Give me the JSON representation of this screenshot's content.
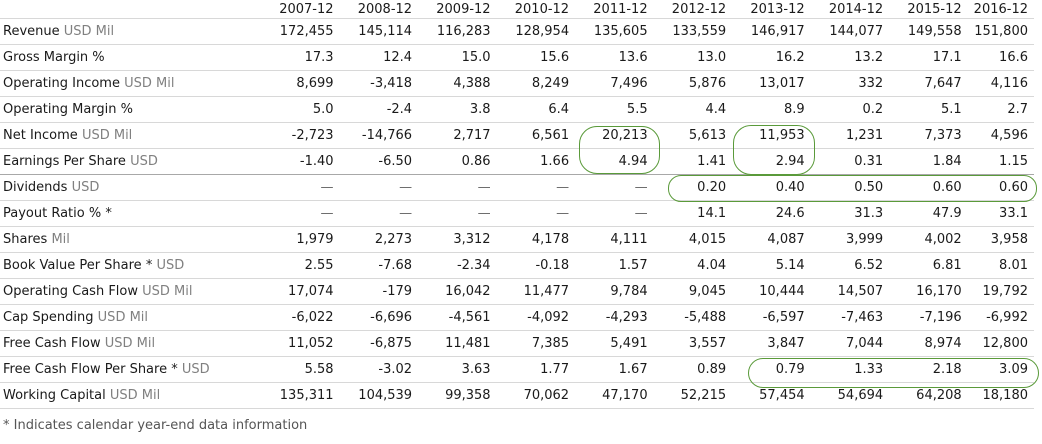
{
  "years": [
    "2007-12",
    "2008-12",
    "2009-12",
    "2010-12",
    "2011-12",
    "2012-12",
    "2013-12",
    "2014-12",
    "2015-12",
    "2016-12"
  ],
  "rows": [
    {
      "metric": "Revenue",
      "unit": "USD Mil",
      "values": [
        "172,455",
        "145,114",
        "116,283",
        "128,954",
        "135,605",
        "133,559",
        "146,917",
        "144,077",
        "149,558",
        "151,800"
      ]
    },
    {
      "metric": "Gross Margin %",
      "unit": "",
      "values": [
        "17.3",
        "12.4",
        "15.0",
        "15.6",
        "13.6",
        "13.0",
        "16.2",
        "13.2",
        "17.1",
        "16.6"
      ]
    },
    {
      "metric": "Operating Income",
      "unit": "USD Mil",
      "values": [
        "8,699",
        "-3,418",
        "4,388",
        "8,249",
        "7,496",
        "5,876",
        "13,017",
        "332",
        "7,647",
        "4,116"
      ]
    },
    {
      "metric": "Operating Margin %",
      "unit": "",
      "values": [
        "5.0",
        "-2.4",
        "3.8",
        "6.4",
        "5.5",
        "4.4",
        "8.9",
        "0.2",
        "5.1",
        "2.7"
      ]
    },
    {
      "metric": "Net Income",
      "unit": "USD Mil",
      "values": [
        "-2,723",
        "-14,766",
        "2,717",
        "6,561",
        "20,213",
        "5,613",
        "11,953",
        "1,231",
        "7,373",
        "4,596"
      ]
    },
    {
      "metric": "Earnings Per Share",
      "unit": "USD",
      "values": [
        "-1.40",
        "-6.50",
        "0.86",
        "1.66",
        "4.94",
        "1.41",
        "2.94",
        "0.31",
        "1.84",
        "1.15"
      ]
    },
    {
      "metric": "Dividends",
      "unit": "USD",
      "values": [
        "—",
        "—",
        "—",
        "—",
        "—",
        "0.20",
        "0.40",
        "0.50",
        "0.60",
        "0.60"
      ]
    },
    {
      "metric": "Payout Ratio % *",
      "unit": "",
      "values": [
        "—",
        "—",
        "—",
        "—",
        "—",
        "14.1",
        "24.6",
        "31.3",
        "47.9",
        "33.1"
      ]
    },
    {
      "metric": "Shares",
      "unit": "Mil",
      "values": [
        "1,979",
        "2,273",
        "3,312",
        "4,178",
        "4,111",
        "4,015",
        "4,087",
        "3,999",
        "4,002",
        "3,958"
      ]
    },
    {
      "metric": "Book Value Per Share *",
      "unit": "USD",
      "values": [
        "2.55",
        "-7.68",
        "-2.34",
        "-0.18",
        "1.57",
        "4.04",
        "5.14",
        "6.52",
        "6.81",
        "8.01"
      ]
    },
    {
      "metric": "Operating Cash Flow",
      "unit": "USD Mil",
      "values": [
        "17,074",
        "-179",
        "16,042",
        "11,477",
        "9,784",
        "9,045",
        "10,444",
        "14,507",
        "16,170",
        "19,792"
      ]
    },
    {
      "metric": "Cap Spending",
      "unit": "USD Mil",
      "values": [
        "-6,022",
        "-6,696",
        "-4,561",
        "-4,092",
        "-4,293",
        "-5,488",
        "-6,597",
        "-7,463",
        "-7,196",
        "-6,992"
      ]
    },
    {
      "metric": "Free Cash Flow",
      "unit": "USD Mil",
      "values": [
        "11,052",
        "-6,875",
        "11,481",
        "7,385",
        "5,491",
        "3,557",
        "3,847",
        "7,044",
        "8,974",
        "12,800"
      ]
    },
    {
      "metric": "Free Cash Flow Per Share *",
      "unit": "USD",
      "values": [
        "5.58",
        "-3.02",
        "3.63",
        "1.77",
        "1.67",
        "0.89",
        "0.79",
        "1.33",
        "2.18",
        "3.09"
      ]
    },
    {
      "metric": "Working Capital",
      "unit": "USD Mil",
      "values": [
        "135,311",
        "104,539",
        "99,358",
        "70,062",
        "47,170",
        "52,215",
        "57,454",
        "54,694",
        "64,208",
        "18,180"
      ]
    }
  ],
  "footnote": "* Indicates calendar year-end data information",
  "highlight_color": "#5a9a3a",
  "unit_color": "#808080"
}
